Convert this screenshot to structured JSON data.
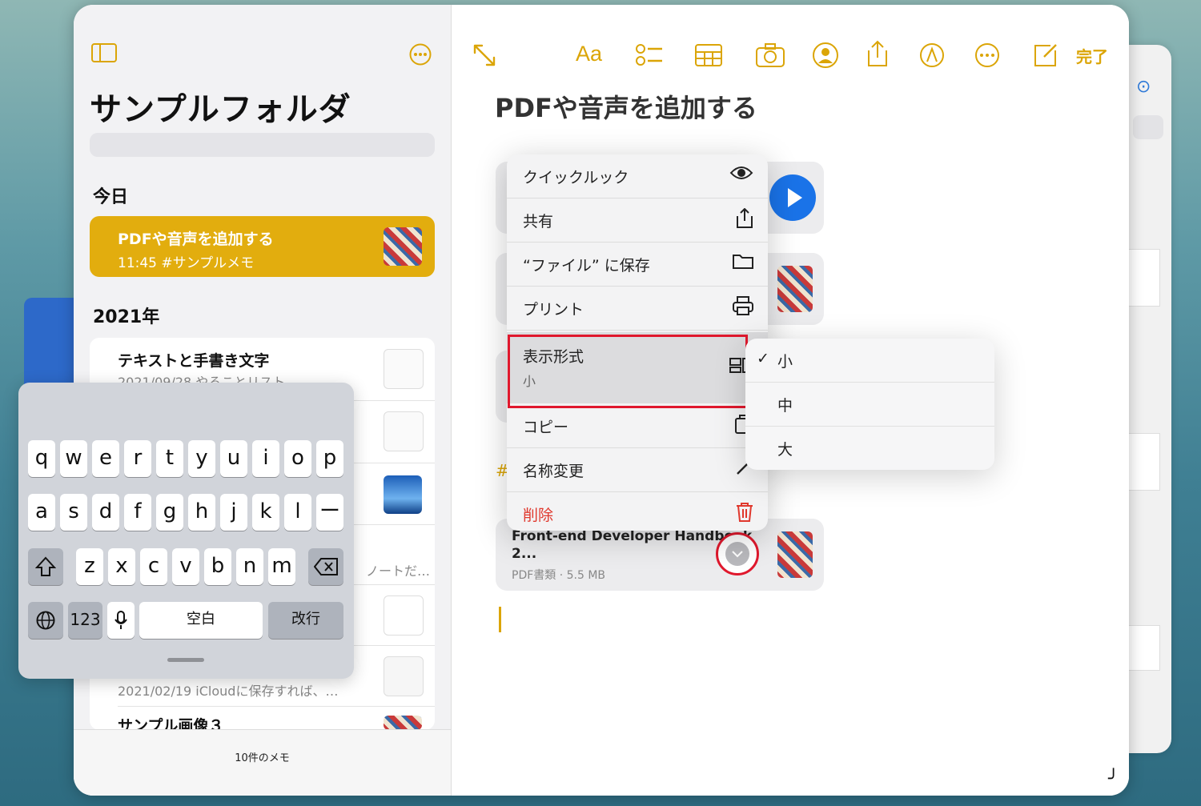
{
  "sidebar": {
    "title": "サンプルフォルダ",
    "section_today": "今日",
    "section_2021": "2021年",
    "selected_note": {
      "title": "PDFや音声を追加する",
      "subtitle": "11:45 #サンプルメモ"
    },
    "notes": [
      {
        "title": "テキストと手書き文字",
        "subtitle": "2021/09/28 やることリスト"
      },
      {
        "title": "",
        "subtitle": "ノートだ…"
      },
      {
        "title": "",
        "subtitle": "2021/02/19 iCloudに保存すれば、…"
      },
      {
        "title": "サンプル画像３",
        "subtitle": ""
      }
    ],
    "footer": "10件のメモ"
  },
  "toolbar": {
    "text_format": "Aa",
    "done": "完了"
  },
  "note": {
    "title": "PDFや音声を追加する",
    "attachment": {
      "name_line1": "Front-end Developer Handbook",
      "name_line2": "2...",
      "meta": "PDF書類 · 5.5 MB"
    },
    "hashtag_char": "#"
  },
  "context_menu": {
    "items": [
      {
        "label": "クイックルック",
        "icon": "eye-icon"
      },
      {
        "label": "共有",
        "icon": "share-icon"
      },
      {
        "label": "“ファイル” に保存",
        "icon": "folder-icon"
      },
      {
        "label": "プリント",
        "icon": "printer-icon"
      },
      {
        "label": "表示形式",
        "sublabel": "小",
        "icon": "view-mode-icon"
      },
      {
        "label": "コピー",
        "icon": "copy-icon"
      },
      {
        "label": "名称変更",
        "icon": "pencil-icon"
      },
      {
        "label": "削除",
        "icon": "trash-icon"
      }
    ],
    "submenu": {
      "checkmark": "✓",
      "options": [
        "小",
        "中",
        "大"
      ],
      "selected": "小"
    }
  },
  "keyboard": {
    "row1": [
      "q",
      "w",
      "e",
      "r",
      "t",
      "y",
      "u",
      "i",
      "o",
      "p"
    ],
    "row2": [
      "a",
      "s",
      "d",
      "f",
      "g",
      "h",
      "j",
      "k",
      "l",
      "ー"
    ],
    "row3": [
      "z",
      "x",
      "c",
      "v",
      "b",
      "n",
      "m"
    ],
    "numbers": "123",
    "space": "空白",
    "return": "改行"
  },
  "colors": {
    "accent": "#dba507",
    "highlight_red": "#e0182d",
    "selected_note_bg": "#e2ad0e",
    "delete_red": "#e0382d",
    "play_blue": "#1a73e8"
  }
}
